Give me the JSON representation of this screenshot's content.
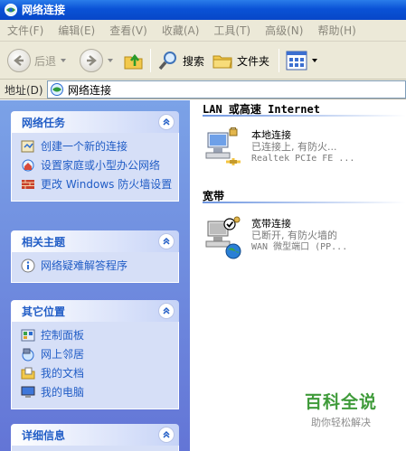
{
  "window": {
    "title": "网络连接"
  },
  "menu": {
    "items": [
      "文件(F)",
      "编辑(E)",
      "查看(V)",
      "收藏(A)",
      "工具(T)",
      "高级(N)",
      "帮助(H)"
    ]
  },
  "toolbar": {
    "back_label": "后退",
    "search_label": "搜索",
    "folders_label": "文件夹"
  },
  "address": {
    "label": "地址(D)",
    "value": "网络连接"
  },
  "sidebar": {
    "network_tasks": {
      "title": "网络任务",
      "items": [
        "创建一个新的连接",
        "设置家庭或小型办公网络",
        "更改 Windows 防火墙设置"
      ]
    },
    "see_also": {
      "title": "相关主题",
      "items": [
        "网络疑难解答程序"
      ]
    },
    "other_places": {
      "title": "其它位置",
      "items": [
        "控制面板",
        "网上邻居",
        "我的文档",
        "我的电脑"
      ]
    },
    "details": {
      "title": "详细信息"
    }
  },
  "groups": {
    "lan": {
      "header": "LAN 或高速 Internet",
      "connection": {
        "name": "本地连接",
        "status": "已连接上, 有防火...",
        "device": "Realtek PCIe FE ..."
      }
    },
    "broadband": {
      "header": "宽带",
      "connection": {
        "name": "宽带连接",
        "status": "已断开, 有防火墙的",
        "device": "WAN 微型端口 (PP..."
      }
    }
  },
  "watermark": {
    "brand": "百科全说",
    "tagline": "助你轻松解决"
  },
  "colors": {
    "titlebar": "#0a52d6",
    "sidebar_bg": "#6d8fe0",
    "link": "#215dc6",
    "watermark_green": "#3f9b3a"
  }
}
